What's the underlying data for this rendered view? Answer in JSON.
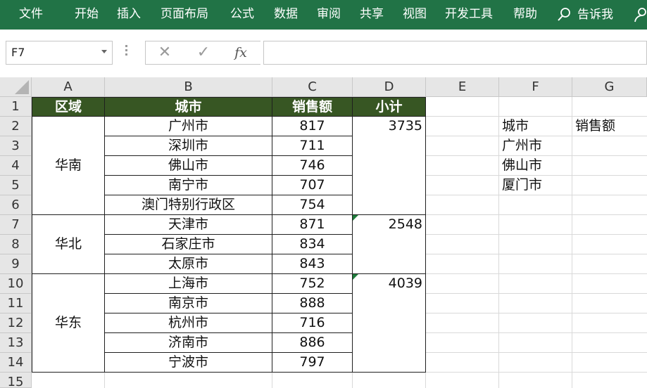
{
  "ribbon": {
    "tabs": [
      "文件",
      "开始",
      "插入",
      "页面布局",
      "公式",
      "数据",
      "审阅",
      "共享",
      "视图",
      "开发工具",
      "帮助"
    ],
    "tell_me": "告诉我"
  },
  "formula_bar": {
    "name_box": "F7",
    "cancel": "✕",
    "enter": "✓",
    "fx": "fx",
    "formula": ""
  },
  "columns": [
    "A",
    "B",
    "C",
    "D",
    "E",
    "F",
    "G"
  ],
  "rows": [
    "1",
    "2",
    "3",
    "4",
    "5",
    "6",
    "7",
    "8",
    "9",
    "10",
    "11",
    "12",
    "13",
    "14",
    "15"
  ],
  "table": {
    "headers": [
      "区域",
      "城市",
      "销售额",
      "小计"
    ],
    "regions": [
      "华南",
      "华北",
      "华东"
    ],
    "cities": [
      "广州市",
      "深圳市",
      "佛山市",
      "南宁市",
      "澳门特别行政区",
      "天津市",
      "石家庄市",
      "太原市",
      "上海市",
      "南京市",
      "杭州市",
      "济南市",
      "宁波市"
    ],
    "sales": [
      "817",
      "711",
      "746",
      "707",
      "754",
      "871",
      "834",
      "843",
      "752",
      "888",
      "716",
      "886",
      "797"
    ],
    "subtotals": [
      "3735",
      "2548",
      "4039"
    ]
  },
  "lookup": {
    "city_header": "城市",
    "sales_header": "销售额",
    "cities": [
      "广州市",
      "佛山市",
      "厦门市"
    ]
  },
  "colors": {
    "ribbon": "#217346",
    "header_fill": "#375623",
    "error_flag": "#1e7b3a"
  }
}
